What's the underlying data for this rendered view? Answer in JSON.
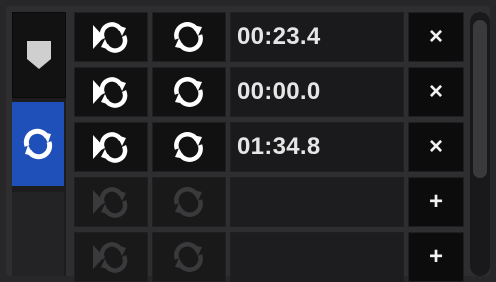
{
  "side_tabs": [
    {
      "icon": "cue-marker-icon",
      "active": false
    },
    {
      "icon": "loop-icon",
      "active": true
    }
  ],
  "rows": [
    {
      "time": "00:23.4",
      "action": "×",
      "action_icon": "remove-icon",
      "enabled": true
    },
    {
      "time": "00:00.0",
      "action": "×",
      "action_icon": "remove-icon",
      "enabled": true
    },
    {
      "time": "01:34.8",
      "action": "×",
      "action_icon": "remove-icon",
      "enabled": true
    },
    {
      "time": "",
      "action": "+",
      "action_icon": "add-icon",
      "enabled": false
    },
    {
      "time": "",
      "action": "+",
      "action_icon": "add-icon",
      "enabled": false
    }
  ],
  "colors": {
    "accent": "#1f4fb8",
    "icon_enabled": "#ffffff",
    "icon_disabled": "#3a3a3c"
  }
}
